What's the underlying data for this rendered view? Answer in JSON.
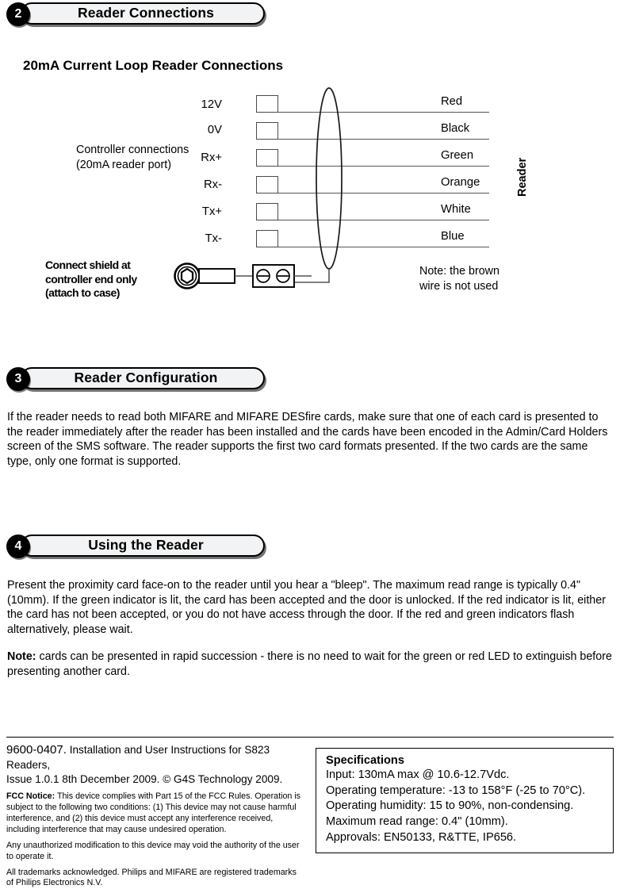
{
  "sections": [
    {
      "number": "2",
      "title": "Reader Connections"
    },
    {
      "number": "3",
      "title": "Reader Configuration"
    },
    {
      "number": "4",
      "title": "Using the Reader"
    }
  ],
  "diagram": {
    "title": "20mA Current Loop Reader Connections",
    "controller_caption_line1": "Controller connections",
    "controller_caption_line2": "(20mA reader port)",
    "reader_label": "Reader",
    "pins": [
      "12V",
      "0V",
      "Rx+",
      "Rx-",
      "Tx+",
      "Tx-"
    ],
    "wire_colors": [
      "Red",
      "Black",
      "Green",
      "Orange",
      "White",
      "Blue"
    ],
    "shield_note_line1": "Connect shield at",
    "shield_note_line2": "controller end only",
    "shield_note_line3": "(attach to case)",
    "brown_note_line1": "Note: the brown",
    "brown_note_line2": "wire is not used"
  },
  "configuration": {
    "body": "If the reader needs to read both MIFARE and MIFARE DESfire cards, make sure that one of each card is presented to the reader immediately after the reader has been installed and the cards have been encoded in the Admin/Card Holders screen of the SMS software. The reader supports the first two card formats presented. If the two cards are the same type, only one format is supported."
  },
  "using": {
    "body": "Present the proximity card face-on to the reader until you hear a \"bleep\". The maximum read range is typically 0.4\" (10mm). If the green indicator is lit, the card has been accepted and the door is unlocked. If the red indicator is lit, either the card has not been accepted, or you do not have access through the door. If the red and green indicators flash alternatively, please wait.",
    "note_label": "Note:",
    "note_body": "cards can be presented in rapid succession - there is no need to wait for the green or red LED to extinguish before presenting another card."
  },
  "footer": {
    "doc_number": "9600-0407.",
    "doc_title": "Installation and User Instructions for S823 Readers,",
    "doc_issue": "Issue 1.0.1 8th December 2009. © G4S Technology 2009.",
    "fcc_label": "FCC Notice:",
    "fcc_body": "This device complies with Part 15 of the FCC Rules. Operation is subject to the following two conditions: (1) This device may not cause harmful interference, and (2) this device must accept any interference received, including interference that may cause undesired operation.",
    "modification_notice": "Any unauthorized modification to this device may void the authority of the user to operate it.",
    "trademark_notice": "All trademarks acknowledged. Philips and MIFARE are registered trademarks of Philips Electronics N.V."
  },
  "specifications": {
    "title": "Specifications",
    "lines": [
      "Input: 130mA max @ 10.6-12.7Vdc.",
      "Operating temperature: -13 to 158°F (-25 to 70°C).",
      "Operating humidity: 15 to 90%, non-condensing.",
      "Maximum read range: 0.4\" (10mm).",
      "Approvals: EN50133, R&TTE, IP656."
    ]
  }
}
